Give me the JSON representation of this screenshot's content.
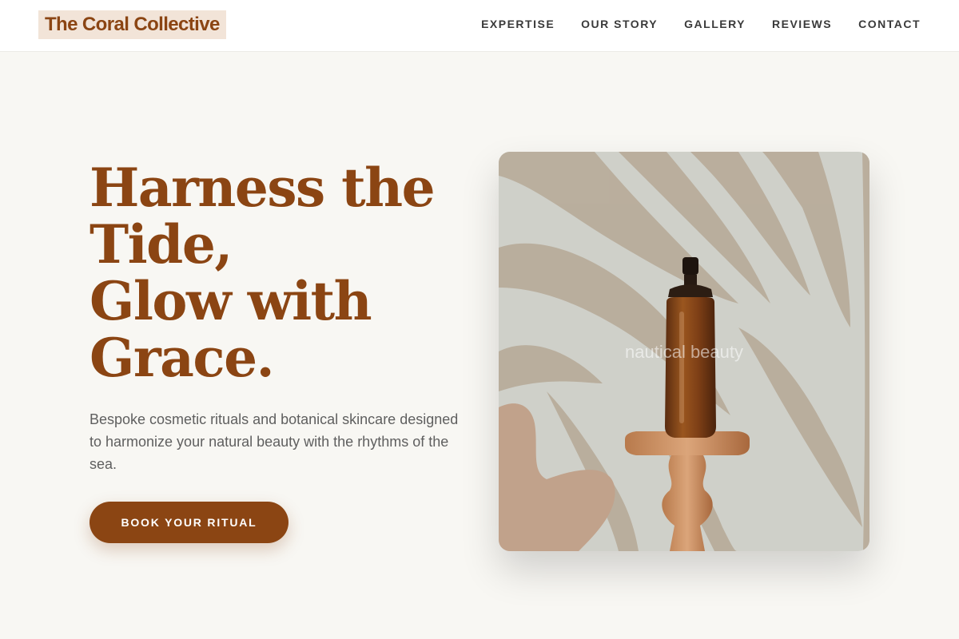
{
  "header": {
    "logo_text": "The Coral Collective",
    "nav": [
      "EXPERTISE",
      "OUR STORY",
      "GALLERY",
      "REVIEWS",
      "CONTACT"
    ]
  },
  "hero": {
    "title_lines": [
      "Harness the",
      "Tide,",
      "Glow with",
      "Grace."
    ],
    "subtitle": "Bespoke cosmetic rituals and botanical skincare designed to harmonize your natural beauty with the rhythms of the sea.",
    "cta_label": "BOOK YOUR RITUAL",
    "image_alt": "nautical beauty"
  },
  "colors": {
    "brand": "#8b4513",
    "logo_bg": "#f2e4d8",
    "page_bg": "#f8f7f3"
  }
}
